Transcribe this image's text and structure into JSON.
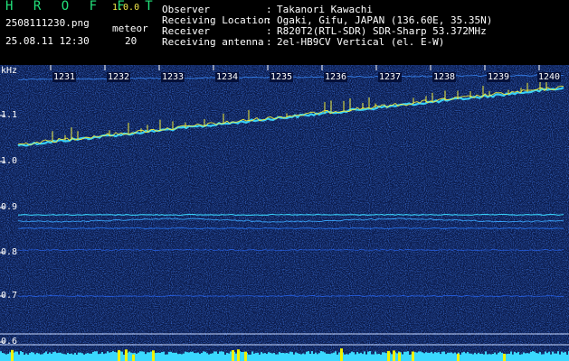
{
  "header": {
    "app_title": "H R O F F T",
    "app_version": "1.0.0",
    "file_name": "2508111230.png",
    "date_time": "25.08.11 12:30",
    "meteor_label": "meteor",
    "meteor_count": "20",
    "info": [
      {
        "label": "Observer",
        "value": "Takanori Kawachi"
      },
      {
        "label": "Receiving Location",
        "value": "Ogaki, Gifu, JAPAN (136.60E, 35.35N)"
      },
      {
        "label": "Receiver",
        "value": "R820T2(RTL-SDR) SDR-Sharp 53.372MHz"
      },
      {
        "label": "Receiving antenna",
        "value": "2el-HB9CV Vertical (el. E-W)"
      }
    ],
    "separator": ":"
  },
  "spectrogram": {
    "unit": "kHz",
    "freq_labels": [
      "1.1",
      "1.0",
      "0.9",
      "0.8",
      "0.7",
      "0.6"
    ],
    "time_labels": [
      "1231",
      "1232",
      "1233",
      "1234",
      "1235",
      "1236",
      "1237",
      "1238",
      "1239",
      "1240"
    ]
  },
  "colors": {
    "background": "#0a1a4a",
    "title_green": "#22e07a",
    "version_yellow": "#f2e94a",
    "signal_cyan": "#3ad8ff",
    "signal_yellow": "#f2ee3a",
    "meteor_bar": "#f0f000"
  }
}
